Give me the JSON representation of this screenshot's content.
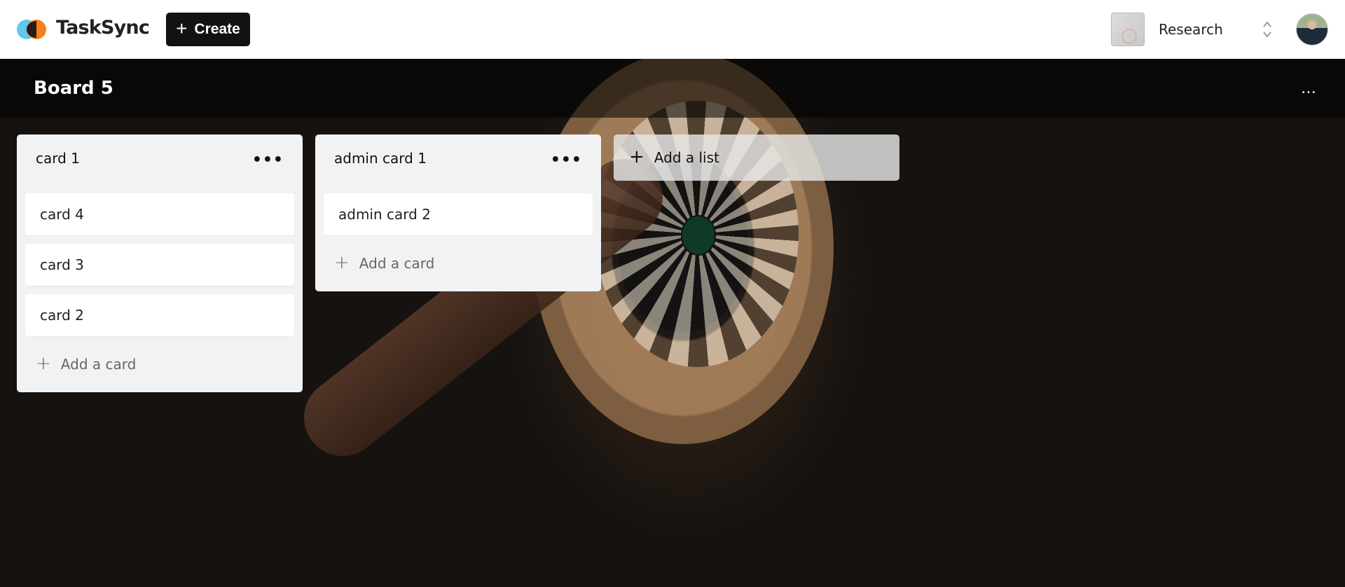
{
  "topbar": {
    "brand": "TaskSync",
    "create_label": "Create",
    "organization": "Research"
  },
  "board": {
    "title": "Board 5",
    "menu_glyph": "…",
    "lists": [
      {
        "title": "card 1",
        "cards": [
          "card 4",
          "card 3",
          "card 2"
        ],
        "add_card_label": "Add a card"
      },
      {
        "title": "admin card 1",
        "cards": [
          "admin card 2"
        ],
        "add_card_label": "Add a card"
      }
    ],
    "add_list_label": "Add a list"
  }
}
